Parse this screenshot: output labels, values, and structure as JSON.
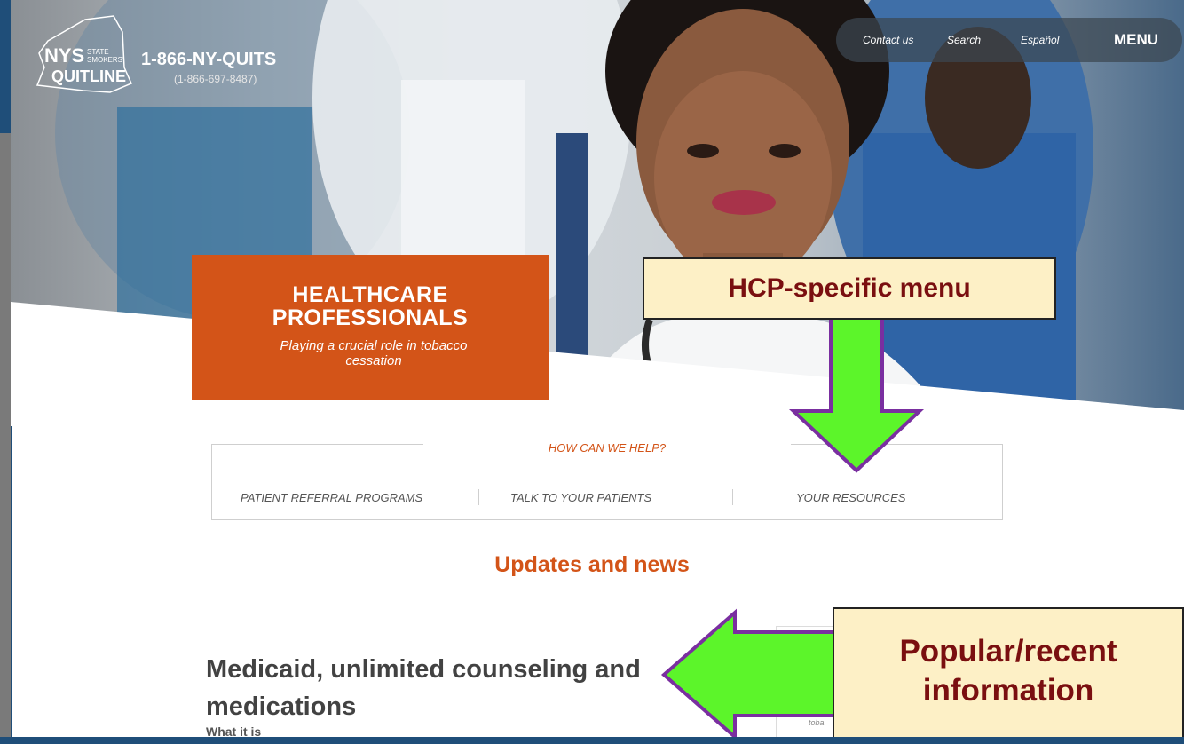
{
  "logo": {
    "nys": "NYS",
    "smokers": "STATE SMOKERS'",
    "quitline": "QUITLINE",
    "phone": "1-866-NY-QUITS",
    "phone_numeric": "(1-866-697-8487)"
  },
  "topnav": {
    "items": [
      "Contact us",
      "Search",
      "Español"
    ],
    "menu": "MENU"
  },
  "hero_card": {
    "line1": "HEALTHCARE",
    "line2": "PROFESSIONALS",
    "subtitle": "Playing a crucial role in tobacco cessation"
  },
  "help": {
    "title": "HOW CAN WE HELP?",
    "links": [
      "PATIENT REFERRAL PROGRAMS",
      "TALK TO YOUR PATIENTS",
      "YOUR RESOURCES"
    ]
  },
  "updates": {
    "heading": "Updates and news",
    "article_title": "Medicaid, unlimited counseling and medications",
    "article_sub": "What it is",
    "side_snippet": "toba"
  },
  "callouts": {
    "hcp_menu": "HCP-specific menu",
    "popular_line1": "Popular/recent",
    "popular_line2": "information"
  },
  "colors": {
    "brand_orange": "#d35418",
    "callout_bg": "#fdf0c6",
    "callout_text": "#7a0f10",
    "arrow_green": "#5cf52a",
    "arrow_outline": "#7a2fa0",
    "frame_blue": "#1f4e79"
  }
}
